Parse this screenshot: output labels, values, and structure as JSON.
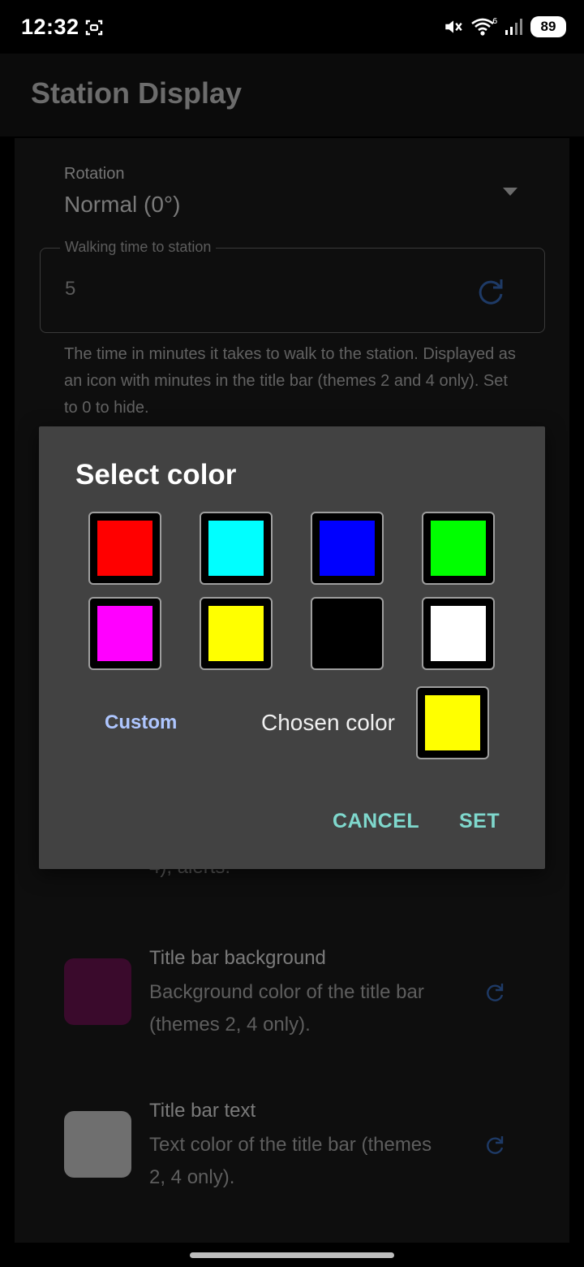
{
  "status_bar": {
    "time": "12:32",
    "battery": "89",
    "network_label": "6",
    "icons": [
      "screen-record-icon",
      "mute-icon",
      "wifi-icon",
      "signal-icon",
      "battery-icon"
    ]
  },
  "app_bar": {
    "title": "Station Display"
  },
  "settings": {
    "rotation": {
      "label": "Rotation",
      "value": "Normal (0°)"
    },
    "walking_time": {
      "label": "Walking time to station",
      "value": "5",
      "help": "The time in minutes it takes to walk to the station. Displayed as an icon with minutes in the title bar (themes 2 and 4 only). Set to 0 to hide."
    },
    "obscured_tail": "4), alerts.",
    "colors": [
      {
        "title": "Title bar background",
        "description": "Background color of the title bar (themes 2, 4 only).",
        "swatch": "#3a0a2c"
      },
      {
        "title": "Title bar text",
        "description": "Text color of the title bar (themes 2, 4 only).",
        "swatch": "#6f6f6f"
      }
    ]
  },
  "dialog": {
    "title": "Select color",
    "swatches": [
      {
        "name": "red",
        "color": "#ff0000"
      },
      {
        "name": "cyan",
        "color": "#00ffff"
      },
      {
        "name": "blue",
        "color": "#0000ff"
      },
      {
        "name": "green",
        "color": "#00ff00"
      },
      {
        "name": "magenta",
        "color": "#ff00ff"
      },
      {
        "name": "yellow",
        "color": "#ffff00"
      },
      {
        "name": "black",
        "color": "#000000"
      },
      {
        "name": "white",
        "color": "#ffffff"
      }
    ],
    "custom_label": "Custom",
    "chosen_label": "Chosen color",
    "chosen_color": "#ffff00",
    "cancel_label": "CANCEL",
    "set_label": "SET"
  },
  "colors": {
    "accent": "#7fd8cd",
    "custom_link": "#aec6ff",
    "reset_icon": "#1e3a66"
  }
}
